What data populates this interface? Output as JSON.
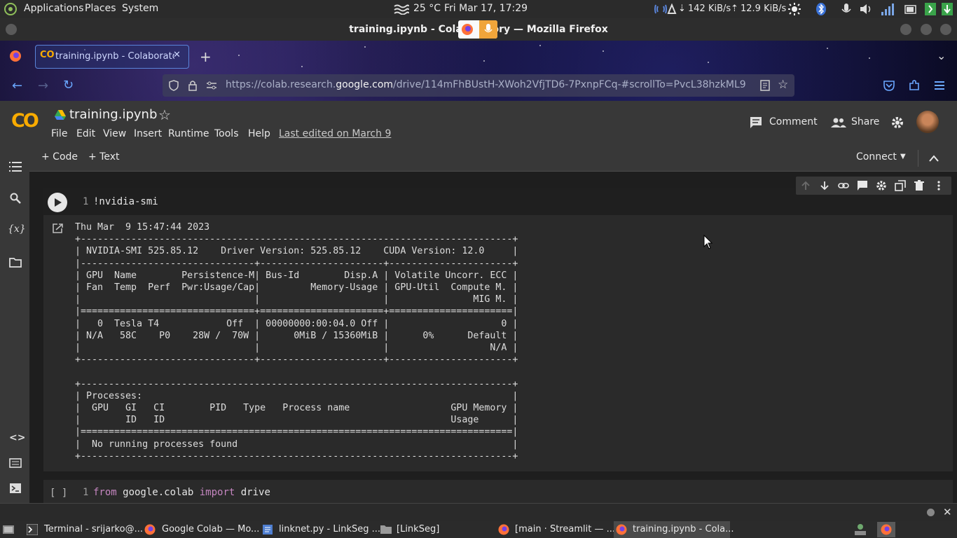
{
  "system_panel": {
    "menus": [
      "Applications",
      "Places",
      "System"
    ],
    "weather": "25 °C",
    "clock": "Fri Mar 17, 17:29",
    "net_down": "142 KiB/s",
    "net_up": "12.9 KiB/s"
  },
  "window": {
    "title": "training.ipynb - Colaboratory — Mozilla Firefox"
  },
  "browser": {
    "tab_title": "training.ipynb - Colaboratory",
    "url_prefix": "https://colab.research.",
    "url_domain": "google.com",
    "url_path": "/drive/114mFhBUstH-XWoh2VfjTD6-7PxnpFCq-#scrollTo=PvcL38hzkML9"
  },
  "colab": {
    "logo": "CO",
    "notebook_title": "training.ipynb",
    "menu": [
      "File",
      "Edit",
      "View",
      "Insert",
      "Runtime",
      "Tools",
      "Help"
    ],
    "last_edited": "Last edited on March 9",
    "comment_label": "Comment",
    "share_label": "Share",
    "add_code_label": "+ Code",
    "add_text_label": "+ Text",
    "connect_label": "Connect"
  },
  "cells": [
    {
      "line_number": "1",
      "code": "!nvidia-smi",
      "output": "Thu Mar  9 15:47:44 2023       \n+-----------------------------------------------------------------------------+\n| NVIDIA-SMI 525.85.12    Driver Version: 525.85.12    CUDA Version: 12.0     |\n|-------------------------------+----------------------+----------------------+\n| GPU  Name        Persistence-M| Bus-Id        Disp.A | Volatile Uncorr. ECC |\n| Fan  Temp  Perf  Pwr:Usage/Cap|         Memory-Usage | GPU-Util  Compute M. |\n|                               |                      |               MIG M. |\n|===============================+======================+======================|\n|   0  Tesla T4            Off  | 00000000:00:04.0 Off |                    0 |\n| N/A   58C    P0    28W /  70W |      0MiB / 15360MiB |      0%      Default |\n|                               |                      |                  N/A |\n+-------------------------------+----------------------+----------------------+\n                                                                               \n+-----------------------------------------------------------------------------+\n| Processes:                                                                  |\n|  GPU   GI   CI        PID   Type   Process name                  GPU Memory |\n|        ID   ID                                                   Usage      |\n|=============================================================================|\n|  No running processes found                                                 |\n+-----------------------------------------------------------------------------+"
    },
    {
      "line_number": "1",
      "run_state": "[ ]",
      "code_kw1": "from",
      "code_mod": " google.colab ",
      "code_kw2": "import",
      "code_name": " drive"
    }
  ],
  "taskbar": [
    {
      "label": "Terminal - srijarko@...",
      "icon": "terminal-icon"
    },
    {
      "label": "Google Colab — Mo...",
      "icon": "firefox-icon"
    },
    {
      "label": "linknet.py - LinkSeg ...",
      "icon": "editor-icon"
    },
    {
      "label": "[LinkSeg]",
      "icon": "folder-icon"
    },
    {
      "label": "[main · Streamlit — ...",
      "icon": "firefox-icon"
    },
    {
      "label": "training.ipynb - Cola...",
      "icon": "firefox-icon"
    }
  ],
  "colors": {
    "colab_orange": "#f9ab00",
    "keyword": "#c586c0",
    "link_blue": "#5a84d9"
  }
}
